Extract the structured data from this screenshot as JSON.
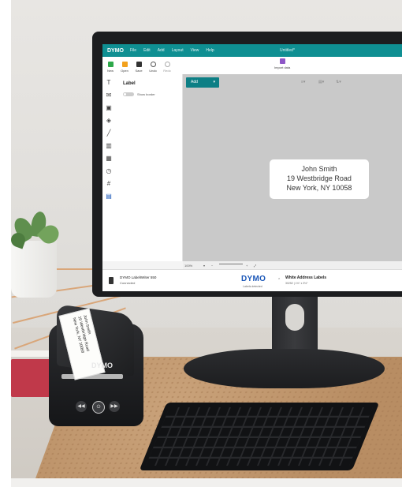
{
  "app": {
    "logo": "DYMO",
    "document_title": "Untitled*",
    "menu": [
      "File",
      "Edit",
      "Add",
      "Layout",
      "View",
      "Help"
    ]
  },
  "toolbar": {
    "new": "New",
    "open": "Open",
    "save": "Save",
    "undo": "Undo",
    "redo": "Redo",
    "import": "Import data"
  },
  "panel": {
    "title": "Label",
    "toggle_text": "Show border"
  },
  "canvas": {
    "add_button": "Add"
  },
  "label": {
    "line1": "John Smith",
    "line2": "19 Westbridge Road",
    "line3": "New York, NY 10058"
  },
  "zoom": {
    "level": "100%"
  },
  "status": {
    "printer_name": "DYMO LabelWriter 550",
    "connection": "Connected",
    "brand": "DYMO",
    "brand_sub": "Labels detected",
    "label_name": "White Address Labels",
    "label_size": "30252  |  1⅛\" x 3½\""
  },
  "printer": {
    "logo": "DYMO",
    "paper_text": [
      "John Smith",
      "19 Westbridge Road",
      "New York, NY 10058"
    ]
  },
  "colors": {
    "app_accent": "#0f8f92",
    "add_button": "#0d7f85",
    "import_icon": "#8e57c7",
    "brand_blue": "#1b57b8"
  }
}
